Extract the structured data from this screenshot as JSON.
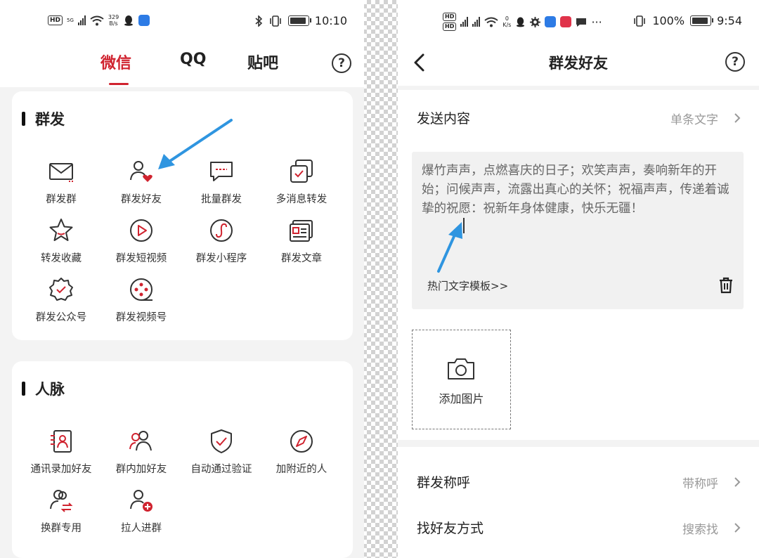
{
  "left": {
    "status": {
      "speed_value": "329",
      "speed_unit": "B/s",
      "time": "10:10"
    },
    "tabs": [
      {
        "label": "微信",
        "active": true
      },
      {
        "label": "QQ",
        "active": false
      },
      {
        "label": "贴吧",
        "active": false
      }
    ],
    "help": "?",
    "sections": [
      {
        "title": "群发",
        "items": [
          {
            "label": "群发群",
            "icon": "mail-icon"
          },
          {
            "label": "群发好友",
            "icon": "friend-heart-icon"
          },
          {
            "label": "批量群发",
            "icon": "chat-bubble-icon"
          },
          {
            "label": "多消息转发",
            "icon": "forward-stack-icon"
          },
          {
            "label": "转发收藏",
            "icon": "star-icon"
          },
          {
            "label": "群发短视频",
            "icon": "play-icon"
          },
          {
            "label": "群发小程序",
            "icon": "mini-program-icon"
          },
          {
            "label": "群发文章",
            "icon": "article-icon"
          },
          {
            "label": "群发公众号",
            "icon": "badge-check-icon"
          },
          {
            "label": "群发视频号",
            "icon": "video-channel-icon"
          }
        ]
      },
      {
        "title": "人脉",
        "items": [
          {
            "label": "通讯录加好友",
            "icon": "contacts-icon"
          },
          {
            "label": "群内加好友",
            "icon": "group-users-icon"
          },
          {
            "label": "自动通过验证",
            "icon": "shield-check-icon"
          },
          {
            "label": "加附近的人",
            "icon": "compass-icon"
          },
          {
            "label": "换群专用",
            "icon": "swap-users-icon"
          },
          {
            "label": "拉人进群",
            "icon": "add-user-icon"
          }
        ]
      }
    ]
  },
  "right": {
    "status": {
      "speed_value": "0",
      "speed_unit": "K/s",
      "battery": "100%",
      "time": "9:54",
      "more": "···"
    },
    "title": "群发好友",
    "help": "?",
    "send_content": {
      "label": "发送内容",
      "value": "单条文字"
    },
    "message": "爆竹声声，点燃喜庆的日子；欢笑声声，奏响新年的开始；问候声声，流露出真心的关怀；祝福声声，传递着诚挚的祝愿：祝新年身体健康，快乐无疆！",
    "template_link": "热门文字模板>>",
    "add_image": "添加图片",
    "salutation": {
      "label": "群发称呼",
      "value": "带称呼"
    },
    "find_method": {
      "label": "找好友方式",
      "value": "搜索找"
    }
  },
  "colors": {
    "accent": "#d0232f",
    "annotation_arrow": "#2f95e0"
  }
}
